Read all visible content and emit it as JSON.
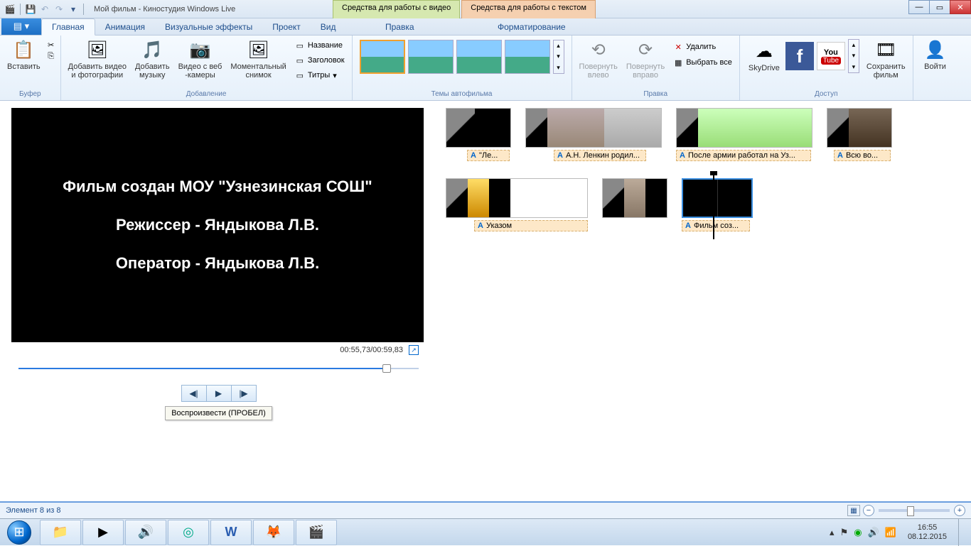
{
  "title": "Мой фильм - Киностудия Windows Live",
  "ctx_tabs": {
    "video": "Средства для работы с видео",
    "text": "Средства для работы с текстом"
  },
  "ctx_sub": {
    "video": "Правка",
    "text": "Форматирование"
  },
  "tabs": {
    "home": "Главная",
    "anim": "Анимация",
    "fx": "Визуальные эффекты",
    "project": "Проект",
    "view": "Вид"
  },
  "ribbon": {
    "buffer": {
      "label": "Буфер",
      "paste": "Вставить"
    },
    "add": {
      "label": "Добавление",
      "add_video": "Добавить видео\nи фотографии",
      "add_music": "Добавить\nмузыку",
      "webcam": "Видео с веб\n-камеры",
      "snapshot": "Моментальный\nснимок",
      "title": "Название",
      "header": "Заголовок",
      "titles": "Титры"
    },
    "themes": {
      "label": "Темы автофильма"
    },
    "edit": {
      "label": "Правка",
      "rot_left": "Повернуть\nвлево",
      "rot_right": "Повернуть\nвправо",
      "delete": "Удалить",
      "select_all": "Выбрать все"
    },
    "share": {
      "label": "Доступ",
      "skydrive": "SkyDrive",
      "save": "Сохранить\nфильм",
      "signin": "Войти"
    }
  },
  "preview": {
    "line1": "Фильм создан МОУ \"Узнезинская СОШ\"",
    "line2": "Режиссер - Яндыкова Л.В.",
    "line3": "Оператор - Яндыкова Л.В.",
    "time": "00:55,73/00:59,83",
    "tooltip": "Воспроизвести (ПРОБЕЛ)"
  },
  "clips": {
    "c1": "\"Ле...",
    "c2": "А.Н. Ленкин родил...",
    "c3": "После армии работал на Уз...",
    "c4": "Всю во...",
    "c5": "Указом",
    "c6": "Фильм соз..."
  },
  "status": {
    "item": "Элемент 8 из 8"
  },
  "tray": {
    "time": "16:55",
    "date": "08.12.2015"
  }
}
